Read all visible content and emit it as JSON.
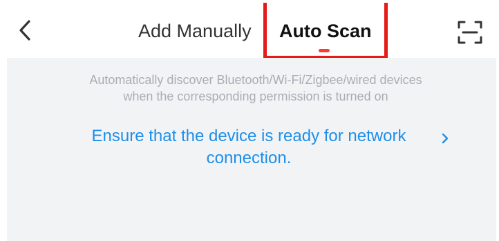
{
  "header": {
    "back_icon": "chevron-left-icon",
    "tabs": [
      {
        "label": "Add Manually",
        "selected": false
      },
      {
        "label": "Auto Scan",
        "selected": true
      }
    ],
    "scan_icon": "scan-icon",
    "accent_color": "#ff3b30",
    "highlight_color": "#e41b17"
  },
  "main": {
    "hint_line1": "Automatically discover Bluetooth/Wi-Fi/Zigbee/wired devices",
    "hint_line2": "when the corresponding permission is turned on",
    "guide_line1": "Ensure that the device is ready for network",
    "guide_line2": "connection.",
    "guide_icon": "chevron-right-icon",
    "link_color": "#1e8fe8"
  }
}
